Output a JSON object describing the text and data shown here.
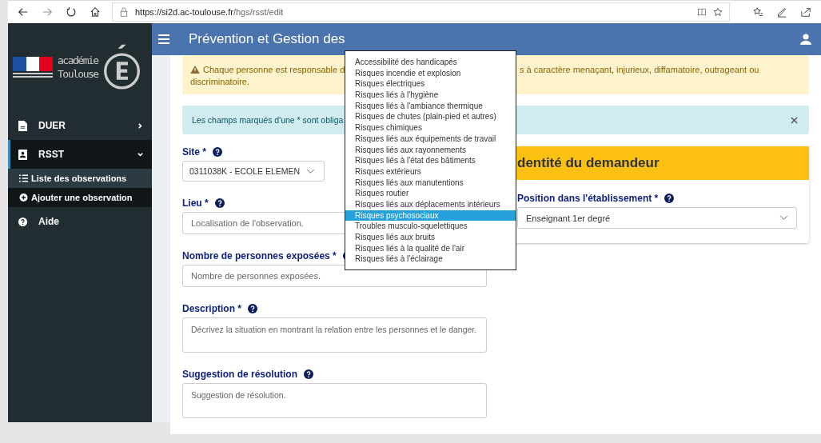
{
  "browser": {
    "url_host": "https://si2d.ac-toulouse.fr",
    "url_path": "/hgs/rsst/edit"
  },
  "sidebar": {
    "logo_lines": [
      "académie",
      "Toulouse"
    ],
    "items": [
      {
        "label": "DUER",
        "expanded": false,
        "selected": false
      },
      {
        "label": "RSST",
        "expanded": true,
        "selected": true,
        "children": [
          {
            "label": "Liste des observations",
            "selected": true
          },
          {
            "label": "Ajouter une observation",
            "selected": false
          }
        ]
      },
      {
        "label": "Aide",
        "selected": false
      }
    ]
  },
  "header": {
    "title": "Prévention et Gestion des"
  },
  "warning": {
    "line1_left": "Chaque personne est responsable d",
    "line1_right": "s à caractère menaçant, injurieux, diffamatoire, outrageant ou",
    "line2": "discriminatoire."
  },
  "info": {
    "text": "Les champs marqués d'une * sont obliga"
  },
  "form": [
    {
      "label": "Site *",
      "kind": "select",
      "value": "0311038K - ECOLE ELEMEN"
    },
    {
      "label": "Lieu *",
      "kind": "input",
      "placeholder": "Localisation de l'observation."
    },
    {
      "label": "Nombre de personnes exposées *",
      "kind": "input",
      "placeholder": "Nombre de personnes exposées."
    },
    {
      "label": "Description *",
      "kind": "textarea",
      "placeholder": "Décrivez la situation en montrant la relation entre les personnes et le danger."
    },
    {
      "label": "Suggestion de résolution",
      "kind": "textarea",
      "placeholder": "Suggestion de résolution."
    }
  ],
  "identity": {
    "title": "dentité du demandeur",
    "field_label": "Position dans l'établissement *",
    "field_value": "Enseignant 1er degré"
  },
  "dropdown": [
    {
      "label": "Accessibilité des handicapés",
      "selected": false
    },
    {
      "label": "Risques incendie et explosion",
      "selected": false
    },
    {
      "label": "Risques électriques",
      "selected": false
    },
    {
      "label": "Risques liés à l'hygiène",
      "selected": false
    },
    {
      "label": "Risques liés à l'ambiance thermique",
      "selected": false
    },
    {
      "label": "Risques de chutes (plain-pied et autres)",
      "selected": false
    },
    {
      "label": "Risques chimiques",
      "selected": false
    },
    {
      "label": "Risques liés aux équipements de travail",
      "selected": false
    },
    {
      "label": "Risques liés aux rayonnements",
      "selected": false
    },
    {
      "label": "Risques liés à l'état des bâtiments",
      "selected": false
    },
    {
      "label": "Risques extérieurs",
      "selected": false
    },
    {
      "label": "Risques liés aux manutentions",
      "selected": false
    },
    {
      "label": "Risques routier",
      "selected": false
    },
    {
      "label": "Risques liés aux déplacements intérieurs",
      "selected": false
    },
    {
      "label": "Risques psychosociaux",
      "selected": true
    },
    {
      "label": "Troubles musculo-squelettiques",
      "selected": false
    },
    {
      "label": "Risques liés aux bruits",
      "selected": false
    },
    {
      "label": "Risques liés à la qualité de l'air",
      "selected": false
    },
    {
      "label": "Risques liés à l'éclairage",
      "selected": false
    }
  ]
}
